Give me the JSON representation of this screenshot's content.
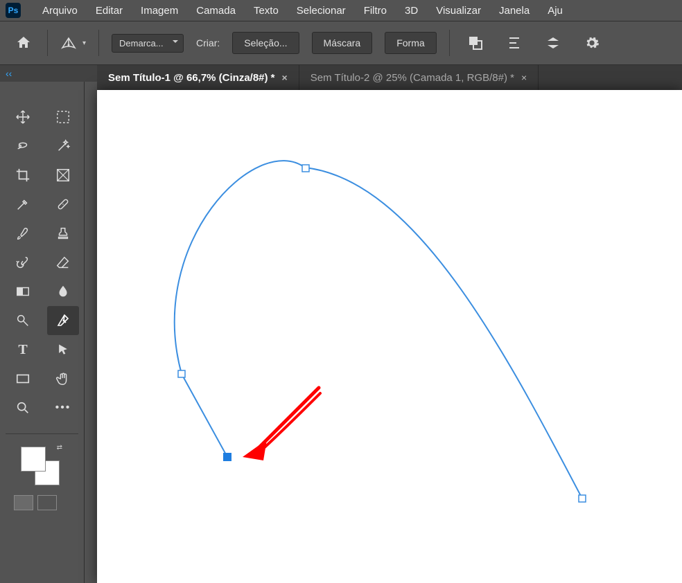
{
  "app": {
    "logo_text": "Ps"
  },
  "menu": {
    "items": [
      "Arquivo",
      "Editar",
      "Imagem",
      "Camada",
      "Texto",
      "Selecionar",
      "Filtro",
      "3D",
      "Visualizar",
      "Janela",
      "Aju"
    ]
  },
  "options": {
    "mode_dropdown": "Demarca...",
    "create_label": "Criar:",
    "selection_btn": "Seleção...",
    "mask_btn": "Máscara",
    "shape_btn": "Forma"
  },
  "tabs": [
    {
      "label": "Sem Título-1 @ 66,7% (Cinza/8#) *",
      "active": true
    },
    {
      "label": "Sem Título-2 @ 25% (Camada 1, RGB/8#) *",
      "active": false
    }
  ],
  "collapse_label": "‹‹",
  "tools": {
    "row1": [
      "move",
      "marquee"
    ],
    "row2": [
      "lasso",
      "magic-wand"
    ],
    "row3": [
      "crop",
      "frame"
    ],
    "row4": [
      "eyedropper",
      "healing"
    ],
    "row5": [
      "brush",
      "stamp"
    ],
    "row6": [
      "history-brush",
      "eraser"
    ],
    "row7": [
      "gradient",
      "blur"
    ],
    "row8": [
      "dodge",
      "pen"
    ],
    "row9": [
      "type",
      "path-select"
    ],
    "row10": [
      "rectangle",
      "hand"
    ],
    "row11": [
      "zoom",
      "more"
    ]
  },
  "colors": {
    "path_stroke": "#3b8ee0",
    "anchor_fill": "#1e7de0",
    "arrow": "#ff0000"
  }
}
